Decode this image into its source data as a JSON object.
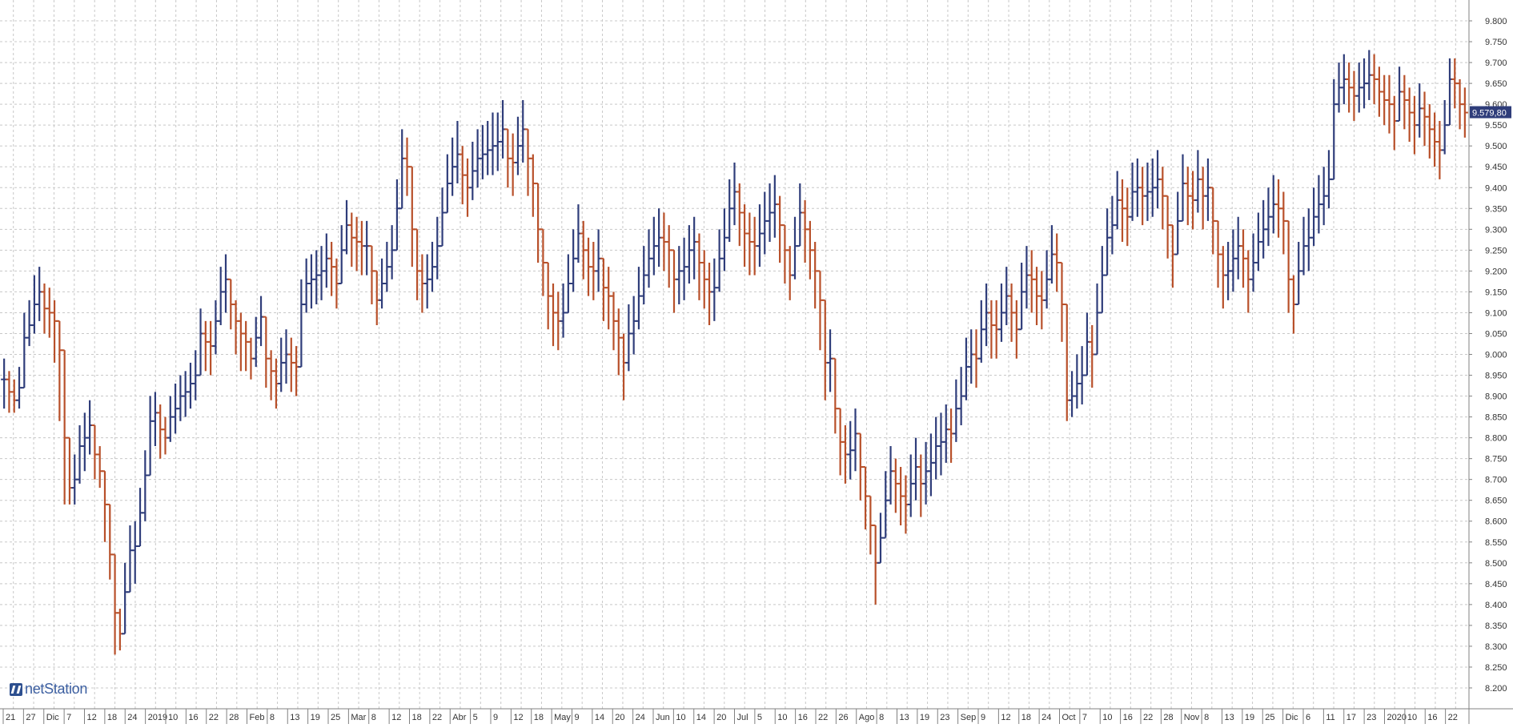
{
  "brand": {
    "name": "netStation"
  },
  "colors": {
    "up": "#2f3d7a",
    "down": "#b8502a",
    "grid": "#c8c8c8",
    "axis": "#808080",
    "price_tag_bg": "#2f3d7a"
  },
  "last_price_label": "9.579,80",
  "chart_data": {
    "type": "ohlc",
    "title": "",
    "xlabel": "",
    "ylabel": "",
    "ylim": [
      8150,
      9850
    ],
    "grid": true,
    "y_ticks": [
      "8.200",
      "8.250",
      "8.300",
      "8.350",
      "8.400",
      "8.450",
      "8.500",
      "8.550",
      "8.600",
      "8.650",
      "8.700",
      "8.750",
      "8.800",
      "8.850",
      "8.900",
      "8.950",
      "9.000",
      "9.050",
      "9.100",
      "9.150",
      "9.200",
      "9.250",
      "9.300",
      "9.350",
      "9.400",
      "9.450",
      "9.500",
      "9.550",
      "9.600",
      "9.650",
      "9.700",
      "9.750",
      "9.800"
    ],
    "x_ticks": [
      "21",
      "27",
      "Dic",
      "7",
      "12",
      "18",
      "24",
      "2019",
      "10",
      "16",
      "22",
      "28",
      "Feb",
      "8",
      "13",
      "19",
      "25",
      "Mar",
      "8",
      "12",
      "18",
      "22",
      "Abr",
      "5",
      "9",
      "12",
      "18",
      "May",
      "9",
      "14",
      "20",
      "24",
      "Jun",
      "10",
      "14",
      "20",
      "Jul",
      "5",
      "10",
      "16",
      "22",
      "26",
      "Ago",
      "8",
      "13",
      "19",
      "23",
      "Sep",
      "9",
      "12",
      "18",
      "24",
      "Oct",
      "7",
      "10",
      "16",
      "22",
      "28",
      "Nov",
      "8",
      "13",
      "19",
      "25",
      "Dic",
      "6",
      "11",
      "17",
      "23",
      "2020",
      "10",
      "16",
      "22"
    ],
    "series": [
      {
        "values": [
          8940,
          8910,
          8890,
          8920,
          9040,
          9070,
          9120,
          9150,
          9110,
          9100,
          9080,
          9010,
          8800,
          8680,
          8700,
          8780,
          8800,
          8830,
          8760,
          8720,
          8640,
          8520,
          8380,
          8330,
          8430,
          8530,
          8540,
          8620,
          8710,
          8840,
          8860,
          8820,
          8800,
          8850,
          8870,
          8900,
          8910,
          8930,
          8950,
          9050,
          9030,
          9020,
          9080,
          9150,
          9180,
          9120,
          9080,
          9050,
          9030,
          8990,
          9040,
          9090,
          8990,
          8960,
          8930,
          8980,
          9000,
          8980,
          8970,
          9120,
          9170,
          9180,
          9190,
          9200,
          9230,
          9210,
          9170,
          9250,
          9310,
          9280,
          9270,
          9260,
          9260,
          9200,
          9130,
          9170,
          9210,
          9250,
          9350,
          9470,
          9450,
          9300,
          9200,
          9170,
          9180,
          9210,
          9260,
          9340,
          9410,
          9450,
          9480,
          9430,
          9400,
          9440,
          9470,
          9480,
          9490,
          9500,
          9510,
          9540,
          9470,
          9460,
          9500,
          9540,
          9470,
          9410,
          9300,
          9220,
          9140,
          9100,
          9080,
          9100,
          9170,
          9230,
          9290,
          9250,
          9210,
          9200,
          9230,
          9160,
          9140,
          9080,
          9040,
          8980,
          9050,
          9080,
          9140,
          9190,
          9230,
          9260,
          9280,
          9270,
          9250,
          9180,
          9200,
          9210,
          9250,
          9270,
          9220,
          9180,
          9150,
          9160,
          9230,
          9280,
          9350,
          9390,
          9340,
          9290,
          9270,
          9260,
          9290,
          9320,
          9340,
          9360,
          9310,
          9250,
          9190,
          9260,
          9340,
          9300,
          9250,
          9200,
          9130,
          8980,
          8990,
          8870,
          8790,
          8760,
          8770,
          8810,
          8730,
          8660,
          8590,
          8500,
          8560,
          8650,
          8720,
          8690,
          8660,
          8640,
          8690,
          8730,
          8690,
          8720,
          8740,
          8780,
          8790,
          8820,
          8810,
          8870,
          8900,
          8970,
          9000,
          8990,
          9060,
          9100,
          9070,
          9060,
          9100,
          9140,
          9100,
          9060,
          9150,
          9190,
          9180,
          9140,
          9130,
          9180,
          9240,
          9220,
          9120,
          8890,
          8900,
          8930,
          8950,
          9030,
          9000,
          9100,
          9190,
          9280,
          9310,
          9370,
          9350,
          9330,
          9390,
          9400,
          9380,
          9390,
          9400,
          9420,
          9380,
          9310,
          9240,
          9320,
          9410,
          9380,
          9370,
          9420,
          9380,
          9400,
          9320,
          9240,
          9190,
          9200,
          9230,
          9260,
          9230,
          9180,
          9220,
          9270,
          9300,
          9330,
          9360,
          9350,
          9320,
          9180,
          9120,
          9200,
          9260,
          9280,
          9330,
          9360,
          9380,
          9420,
          9600,
          9640,
          9660,
          9640,
          9620,
          9640,
          9650,
          9670,
          9660,
          9630,
          9610,
          9600,
          9560,
          9630,
          9610,
          9580,
          9550,
          9590,
          9570,
          9540,
          9510,
          9490,
          9550,
          9660,
          9650,
          9600,
          9580
        ],
        "low": [
          8870,
          8860,
          8860,
          8870,
          8950,
          9020,
          9050,
          9080,
          9050,
          9040,
          8980,
          8840,
          8640,
          8640,
          8640,
          8690,
          8720,
          8760,
          8700,
          8680,
          8550,
          8460,
          8280,
          8290,
          8350,
          8440,
          8450,
          8540,
          8600,
          8720,
          8780,
          8750,
          8760,
          8790,
          8810,
          8840,
          8850,
          8870,
          8890,
          8980,
          8960,
          8950,
          9000,
          9070,
          9100,
          9060,
          9000,
          8960,
          8960,
          8940,
          8970,
          9020,
          8920,
          8890,
          8870,
          8910,
          8930,
          8910,
          8900,
          9040,
          9100,
          9110,
          9120,
          9130,
          9160,
          9140,
          9110,
          9170,
          9240,
          9210,
          9200,
          9190,
          9190,
          9120,
          9070,
          9110,
          9150,
          9180,
          9280,
          9390,
          9380,
          9210,
          9130,
          9100,
          9110,
          9150,
          9180,
          9260,
          9340,
          9380,
          9410,
          9360,
          9330,
          9370,
          9400,
          9420,
          9430,
          9430,
          9440,
          9470,
          9400,
          9380,
          9430,
          9460,
          9380,
          9330,
          9220,
          9140,
          9060,
          9020,
          9010,
          9040,
          9100,
          9150,
          9220,
          9180,
          9140,
          9130,
          9150,
          9080,
          9060,
          9010,
          8950,
          8890,
          8960,
          9000,
          9060,
          9120,
          9160,
          9190,
          9210,
          9200,
          9160,
          9100,
          9120,
          9130,
          9170,
          9180,
          9130,
          9110,
          9070,
          9080,
          9150,
          9200,
          9270,
          9310,
          9260,
          9210,
          9190,
          9190,
          9210,
          9240,
          9270,
          9280,
          9220,
          9170,
          9130,
          9180,
          9260,
          9220,
          9180,
          9110,
          9010,
          8890,
          8910,
          8810,
          8710,
          8690,
          8700,
          8720,
          8650,
          8580,
          8520,
          8400,
          8500,
          8580,
          8640,
          8620,
          8590,
          8570,
          8610,
          8650,
          8610,
          8640,
          8660,
          8700,
          8710,
          8740,
          8740,
          8790,
          8830,
          8890,
          8930,
          8920,
          8980,
          9020,
          8990,
          8990,
          9030,
          9070,
          9030,
          8990,
          9070,
          9110,
          9100,
          9070,
          9060,
          9110,
          9170,
          9150,
          9030,
          8840,
          8850,
          8870,
          8880,
          8950,
          8920,
          9020,
          9110,
          9200,
          9240,
          9300,
          9270,
          9260,
          9320,
          9330,
          9310,
          9320,
          9330,
          9350,
          9300,
          9230,
          9160,
          9240,
          9340,
          9310,
          9300,
          9340,
          9300,
          9320,
          9240,
          9160,
          9110,
          9130,
          9150,
          9180,
          9160,
          9100,
          9150,
          9200,
          9230,
          9260,
          9290,
          9280,
          9240,
          9100,
          9050,
          9130,
          9190,
          9200,
          9260,
          9290,
          9310,
          9350,
          9540,
          9580,
          9600,
          9580,
          9560,
          9580,
          9590,
          9610,
          9600,
          9570,
          9550,
          9530,
          9490,
          9560,
          9540,
          9510,
          9480,
          9520,
          9500,
          9470,
          9450,
          9420,
          9480,
          9610,
          9590,
          9540,
          9520
        ],
        "high": [
          8990,
          8960,
          8940,
          8970,
          9100,
          9130,
          9190,
          9210,
          9170,
          9160,
          9130,
          9080,
          8860,
          8740,
          8760,
          8830,
          8860,
          8890,
          8820,
          8780,
          8710,
          8590,
          8450,
          8390,
          8500,
          8590,
          8600,
          8680,
          8770,
          8900,
          8910,
          8880,
          8850,
          8900,
          8930,
          8950,
          8960,
          8980,
          9010,
          9110,
          9080,
          9080,
          9130,
          9210,
          9240,
          9170,
          9130,
          9100,
          9080,
          9040,
          9090,
          9140,
          9050,
          9010,
          8990,
          9040,
          9060,
          9040,
          9020,
          9180,
          9230,
          9240,
          9250,
          9260,
          9290,
          9270,
          9230,
          9310,
          9370,
          9340,
          9330,
          9320,
          9320,
          9260,
          9190,
          9230,
          9270,
          9310,
          9420,
          9540,
          9520,
          9370,
          9270,
          9240,
          9240,
          9270,
          9330,
          9400,
          9480,
          9520,
          9560,
          9500,
          9470,
          9510,
          9540,
          9550,
          9560,
          9580,
          9580,
          9610,
          9540,
          9530,
          9570,
          9610,
          9540,
          9480,
          9370,
          9290,
          9210,
          9170,
          9150,
          9170,
          9240,
          9300,
          9360,
          9320,
          9280,
          9270,
          9300,
          9230,
          9210,
          9150,
          9110,
          9050,
          9120,
          9140,
          9210,
          9260,
          9300,
          9330,
          9350,
          9340,
          9310,
          9250,
          9260,
          9280,
          9310,
          9330,
          9290,
          9250,
          9220,
          9230,
          9300,
          9350,
          9420,
          9460,
          9410,
          9360,
          9340,
          9330,
          9360,
          9390,
          9410,
          9430,
          9380,
          9310,
          9260,
          9330,
          9410,
          9370,
          9320,
          9270,
          9200,
          9050,
          9060,
          8940,
          8860,
          8830,
          8840,
          8870,
          8800,
          8730,
          8660,
          8570,
          8620,
          8720,
          8780,
          8750,
          8730,
          8710,
          8760,
          8800,
          8760,
          8790,
          8810,
          8850,
          8860,
          8880,
          8870,
          8940,
          8970,
          9040,
          9060,
          9060,
          9130,
          9170,
          9130,
          9130,
          9170,
          9210,
          9170,
          9130,
          9220,
          9260,
          9250,
          9210,
          9200,
          9250,
          9310,
          9290,
          9190,
          8950,
          8960,
          9000,
          9020,
          9100,
          9070,
          9170,
          9260,
          9350,
          9380,
          9440,
          9420,
          9400,
          9460,
          9470,
          9450,
          9460,
          9470,
          9490,
          9450,
          9380,
          9310,
          9390,
          9480,
          9450,
          9440,
          9490,
          9450,
          9470,
          9390,
          9310,
          9260,
          9270,
          9300,
          9330,
          9300,
          9250,
          9290,
          9340,
          9370,
          9400,
          9430,
          9420,
          9390,
          9250,
          9190,
          9270,
          9330,
          9350,
          9400,
          9430,
          9450,
          9490,
          9660,
          9700,
          9720,
          9700,
          9680,
          9700,
          9710,
          9730,
          9720,
          9690,
          9670,
          9670,
          9620,
          9690,
          9670,
          9640,
          9620,
          9650,
          9630,
          9600,
          9580,
          9560,
          9610,
          9710,
          9710,
          9660,
          9640
        ]
      }
    ]
  }
}
